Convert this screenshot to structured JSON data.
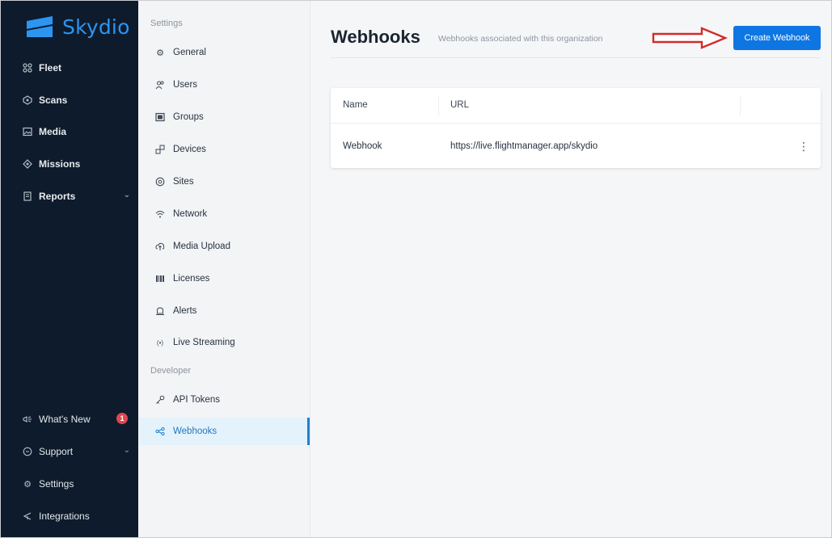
{
  "app": {
    "name": "Skydio",
    "brand_color": "#2b95f1"
  },
  "nav": {
    "items": [
      {
        "label": "Fleet",
        "icon": "drone-icon"
      },
      {
        "label": "Scans",
        "icon": "scan-icon"
      },
      {
        "label": "Media",
        "icon": "image-icon"
      },
      {
        "label": "Missions",
        "icon": "target-icon"
      },
      {
        "label": "Reports",
        "icon": "report-icon"
      }
    ],
    "bottom": [
      {
        "label": "What's New",
        "icon": "megaphone-icon",
        "badge": "1"
      },
      {
        "label": "Support",
        "icon": "chat-icon"
      },
      {
        "label": "Settings",
        "icon": "gear-icon"
      },
      {
        "label": "Integrations",
        "icon": "plug-icon"
      }
    ]
  },
  "settings": {
    "section_settings": "Settings",
    "section_developer": "Developer",
    "items": [
      {
        "label": "General",
        "icon": "gear-icon"
      },
      {
        "label": "Users",
        "icon": "users-icon"
      },
      {
        "label": "Groups",
        "icon": "groups-icon"
      },
      {
        "label": "Devices",
        "icon": "devices-icon"
      },
      {
        "label": "Sites",
        "icon": "location-pin-icon"
      },
      {
        "label": "Network",
        "icon": "wifi-icon"
      },
      {
        "label": "Media Upload",
        "icon": "cloud-upload-icon"
      },
      {
        "label": "Licenses",
        "icon": "barcode-icon"
      },
      {
        "label": "Alerts",
        "icon": "bell-icon"
      },
      {
        "label": "Live Streaming",
        "icon": "broadcast-icon"
      }
    ],
    "dev_items": [
      {
        "label": "API Tokens",
        "icon": "key-icon"
      },
      {
        "label": "Webhooks",
        "icon": "webhook-icon"
      }
    ]
  },
  "main": {
    "title": "Webhooks",
    "subtitle": "Webhooks associated with this organization",
    "create_button": "Create Webhook",
    "accent_color": "#0d76e3",
    "annotation_color": "#d42a2a",
    "table": {
      "headers": [
        "Name",
        "URL"
      ],
      "rows": [
        {
          "name": "Webhook",
          "url": "https://live.flightmanager.app/skydio"
        }
      ]
    }
  }
}
